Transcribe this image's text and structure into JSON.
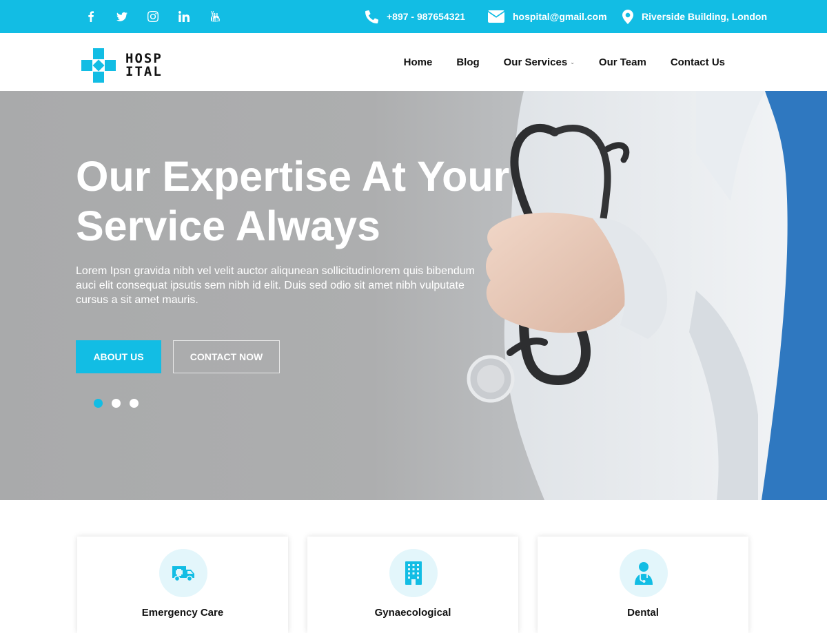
{
  "topbar": {
    "social": [
      "facebook-icon",
      "twitter-icon",
      "instagram-icon",
      "linkedin-icon",
      "youtube-icon"
    ],
    "phone": "+897 - 987654321",
    "email": "hospital@gmail.com",
    "address": "Riverside Building, London"
  },
  "header": {
    "logo": {
      "line1": "HOSP",
      "line2": "ITAL"
    },
    "nav": [
      "Home",
      "Blog",
      "Our Services",
      "Our Team",
      "Contact Us"
    ]
  },
  "hero": {
    "title_line1": "Our Expertise At Your",
    "title_line2": "Service Always",
    "description": "Lorem Ipsn gravida nibh vel velit auctor aliqunean sollicitudinlorem quis bibendum auci elit consequat ipsutis sem nibh id elit. Duis sed odio sit amet nibh vulputate cursus a sit amet mauris.",
    "about_button": "ABOUT US",
    "contact_button": "CONTACT NOW",
    "slides_total": 3,
    "active_slide": 1
  },
  "services": [
    {
      "title": "Emergency Care",
      "icon": "ambulance-icon"
    },
    {
      "title": "Gynaecological",
      "icon": "building-icon"
    },
    {
      "title": "Dental",
      "icon": "doctor-icon"
    }
  ],
  "colors": {
    "accent": "#12bde4",
    "accent_light": "#e3f6fb",
    "hero_gray": "#adaeaf"
  }
}
